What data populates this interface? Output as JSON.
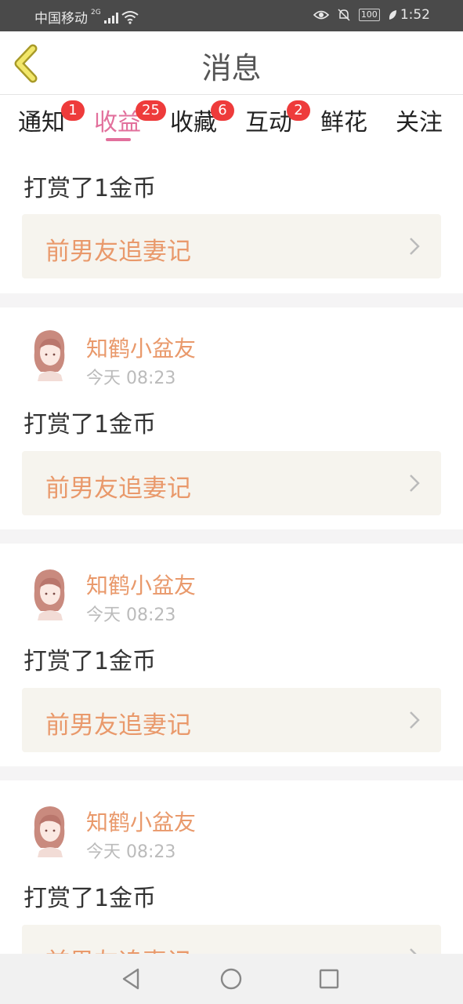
{
  "status_bar": {
    "carrier": "中国移动",
    "network": "2G",
    "battery": "100",
    "time": "1:52"
  },
  "header": {
    "title": "消息"
  },
  "tabs": [
    {
      "label": "通知",
      "badge": "1"
    },
    {
      "label": "收益",
      "badge": "25",
      "active": true
    },
    {
      "label": "收藏",
      "badge": "6"
    },
    {
      "label": "互动",
      "badge": "2"
    },
    {
      "label": "鲜花"
    },
    {
      "label": "关注"
    }
  ],
  "messages": [
    {
      "action": "打赏了1金币",
      "book": "前男友追妻记"
    },
    {
      "user": "知鹤小盆友",
      "time": "今天 08:23",
      "action": "打赏了1金币",
      "book": "前男友追妻记"
    },
    {
      "user": "知鹤小盆友",
      "time": "今天 08:23",
      "action": "打赏了1金币",
      "book": "前男友追妻记"
    },
    {
      "user": "知鹤小盆友",
      "time": "今天 08:23",
      "action": "打赏了1金币",
      "book": "前男友追妻记"
    }
  ],
  "colors": {
    "accent": "#e2709c",
    "badge": "#ee3b3b",
    "username": "#e9996b",
    "book_bg": "#f6f4ee"
  }
}
